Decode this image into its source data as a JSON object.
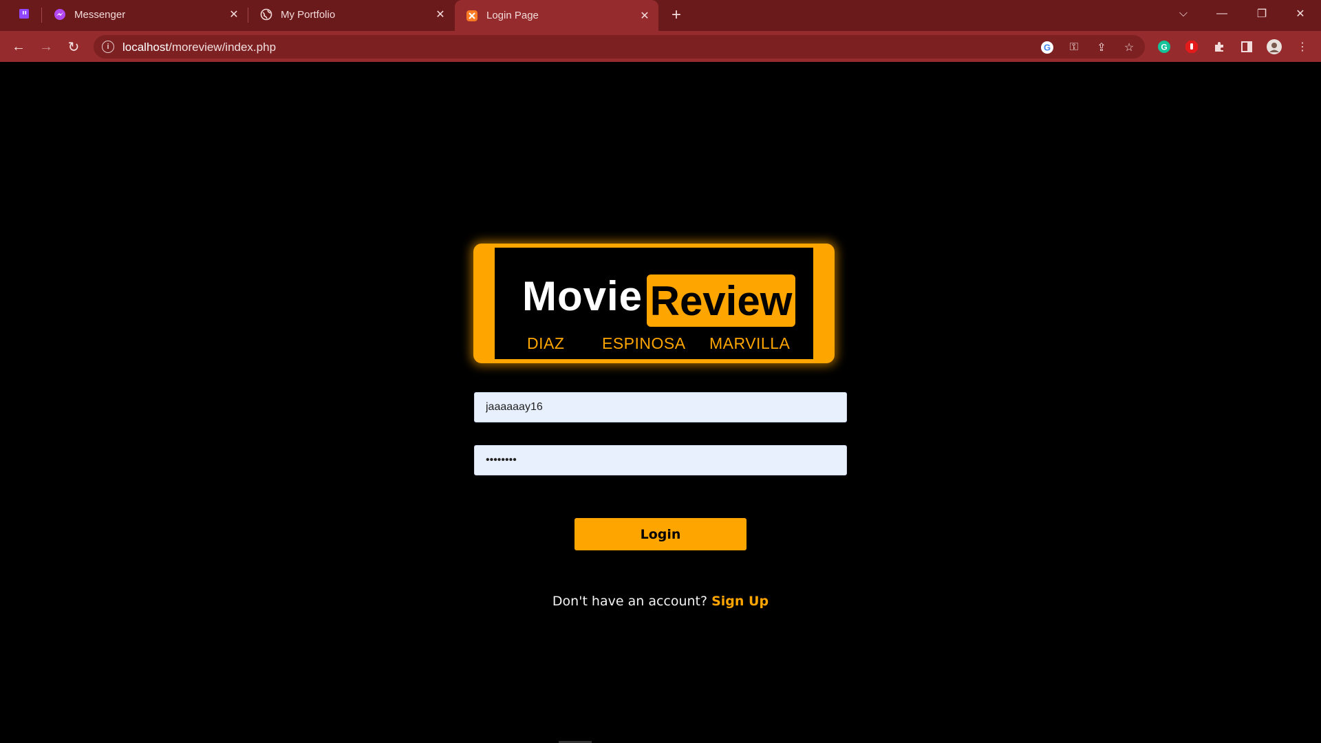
{
  "browser": {
    "tabs": [
      {
        "title": "Messenger",
        "icon": "messenger-icon"
      },
      {
        "title": "My Portfolio",
        "icon": "globe-icon"
      },
      {
        "title": "Login Page",
        "icon": "xampp-icon",
        "active": true
      }
    ],
    "pinned_tab_icon": "twitch-icon",
    "url_domain": "localhost",
    "url_path": "/moreview/index.php",
    "colors": {
      "tabbar": "#6b1a1c",
      "toolbar": "#952b2d"
    }
  },
  "page": {
    "logo": {
      "word1": "Movie",
      "word2": "Review",
      "names": [
        "DIAZ",
        "ESPINOSA",
        "MARVILLA"
      ]
    },
    "form": {
      "username_value": "jaaaaaay16",
      "password_value": "password"
    },
    "login_label": "Login",
    "signup_prompt": "Don't have an account?",
    "signup_link": "Sign Up",
    "colors": {
      "accent": "#ffa500",
      "background": "#000000"
    }
  }
}
